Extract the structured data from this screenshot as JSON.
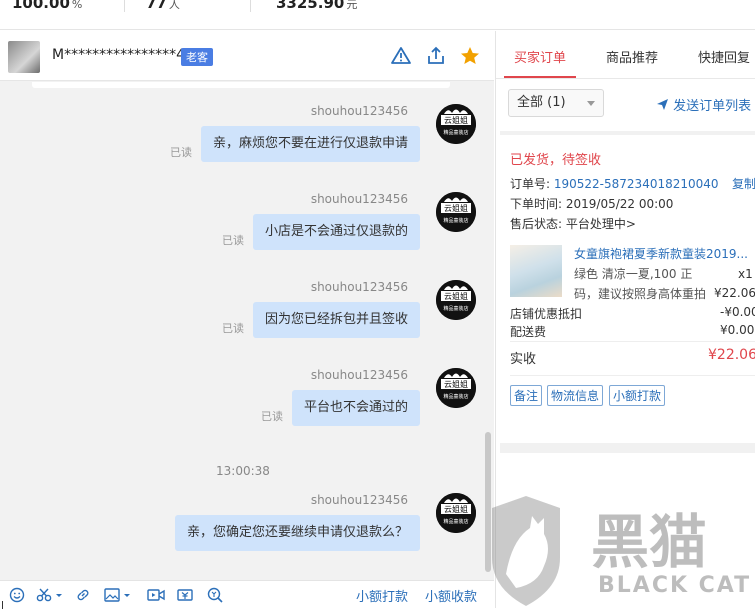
{
  "stats": [
    {
      "value": "100.00",
      "unit": "%"
    },
    {
      "value": "77",
      "unit": "人"
    },
    {
      "value": "3325.90",
      "unit": "元"
    }
  ],
  "chat": {
    "user_name": "M****************4",
    "badge": "老客",
    "messages": [
      {
        "sender": "shouhou123456",
        "text": "亲，麻烦您不要在进行仅退款申请",
        "read": "已读"
      },
      {
        "sender": "shouhou123456",
        "text": "小店是不会通过仅退款的",
        "read": "已读"
      },
      {
        "sender": "shouhou123456",
        "text": "因为您已经拆包并且签收",
        "read": "已读"
      },
      {
        "sender": "shouhou123456",
        "text": "平台也不会通过的",
        "read": "已读"
      },
      {
        "sender": "shouhou123456",
        "text": "亲，您确定您还要继续申请仅退款么？"
      }
    ],
    "timestamp": "13:00:38",
    "bot_avatar_text": [
      "云姐姐",
      "精品童装店"
    ],
    "toolbar": {
      "small_pay": "小额打款",
      "small_collect": "小额收款"
    }
  },
  "side": {
    "tabs": [
      "买家订单",
      "商品推荐",
      "快捷回复"
    ],
    "filter": "全部 (1)",
    "send_orders": "发送订单列表",
    "order": {
      "status": "已发货，待签收",
      "order_no_label": "订单号:",
      "order_no": "190522-587234018210040",
      "copy": "复制",
      "time_label": "下单时间:",
      "time": "2019/05/22 00:00",
      "aftersale_label": "售后状态:",
      "aftersale": "平台处理中>",
      "product_title": "女童旗袍裙夏季新款童装2019...",
      "product_spec1": "绿色 清凉一夏,100 正",
      "product_spec2": "码，建议按照身高体重拍",
      "qty": "x1",
      "price": "¥22.06",
      "discount_label": "店铺优惠抵扣",
      "discount": "-¥0.00",
      "shipping_label": "配送费",
      "shipping": "¥0.00",
      "total_label": "实收",
      "total": "¥22.06",
      "actions": [
        "备注",
        "物流信息",
        "小额打款"
      ]
    }
  },
  "watermark": {
    "cn": "黑猫",
    "en": "BLACK CAT"
  },
  "colors": {
    "accent": "#e0464c",
    "link": "#2b6fb9",
    "bubble": "#cfe3fb",
    "badge": "#4a7de3"
  }
}
